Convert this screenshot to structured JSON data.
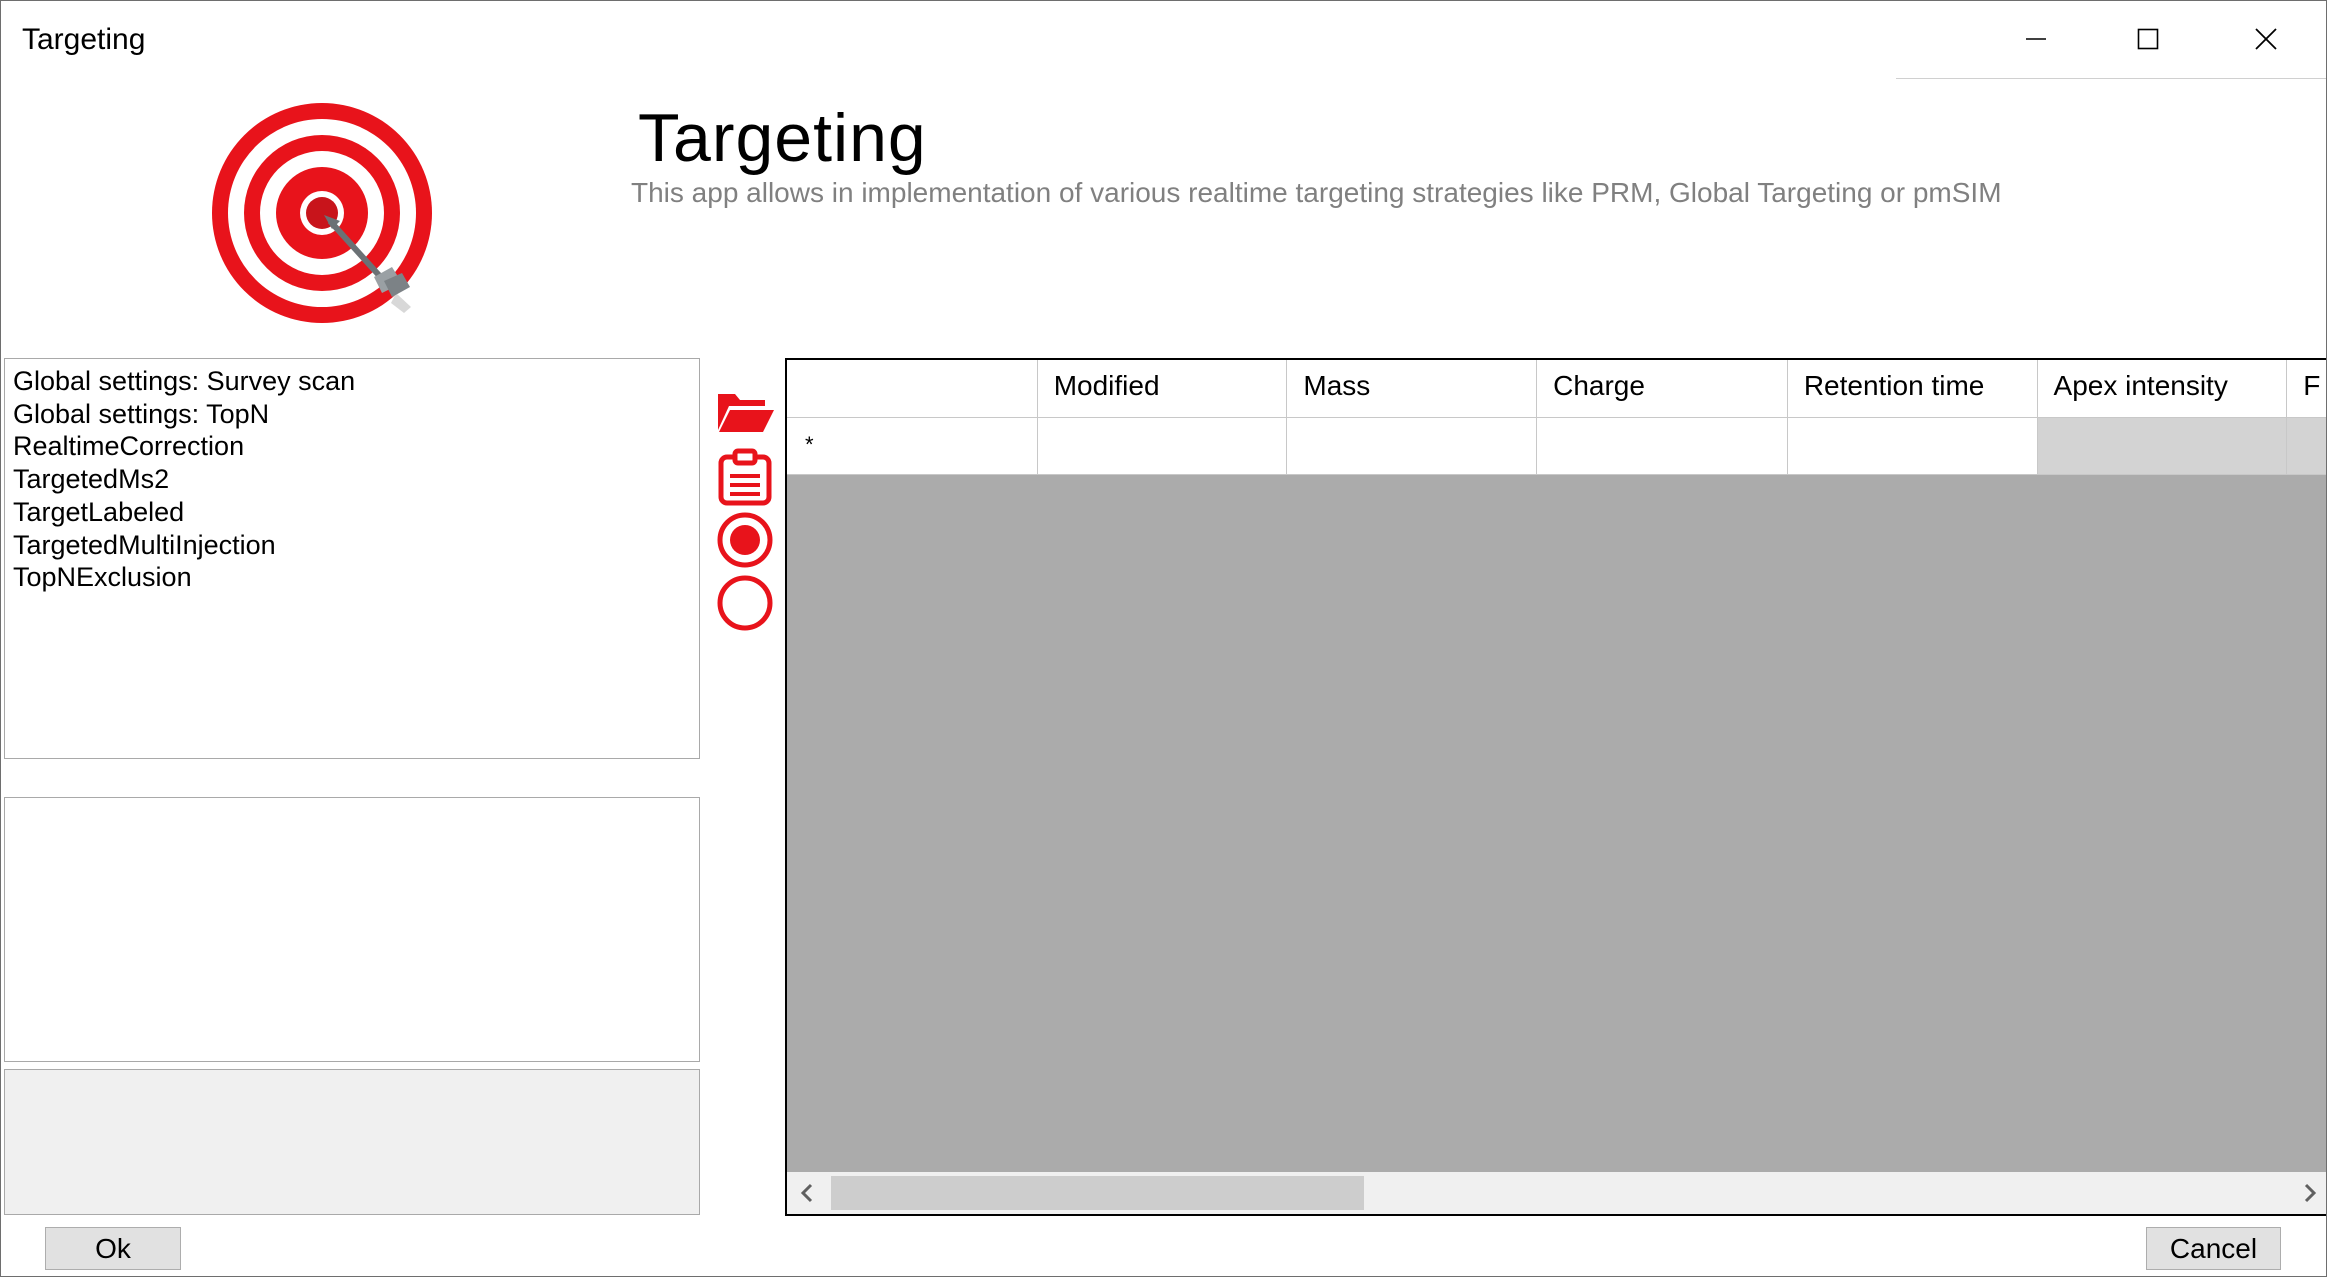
{
  "window": {
    "title": "Targeting",
    "controls": {
      "minimize": "minimize-icon",
      "maximize": "maximize-icon",
      "close": "close-icon"
    }
  },
  "header": {
    "logo_icon": "target-with-arrow-icon",
    "title": "Targeting",
    "description": "This app allows in implementation of various realtime targeting strategies like PRM, Global Targeting or pmSIM"
  },
  "modules": [
    "Global settings: Survey scan",
    "Global settings: TopN",
    "RealtimeCorrection",
    "TargetedMs2",
    "TargetLabeled",
    "TargetedMultiInjection",
    "TopNExclusion"
  ],
  "toolbar": {
    "open": "open-folder-icon",
    "paste": "clipboard-icon",
    "select": "filled-circle-icon",
    "deselect": "empty-circle-icon"
  },
  "grid": {
    "columns": [
      "",
      "Modified",
      "Mass",
      "Charge",
      "Retention time",
      "Apex intensity",
      "F"
    ],
    "new_row_marker": "*"
  },
  "buttons": {
    "ok": "Ok",
    "cancel": "Cancel"
  },
  "colors": {
    "accent_red": "#e8131b",
    "grid_background": "#ababab",
    "readonly_cell": "#d3d3d3"
  }
}
